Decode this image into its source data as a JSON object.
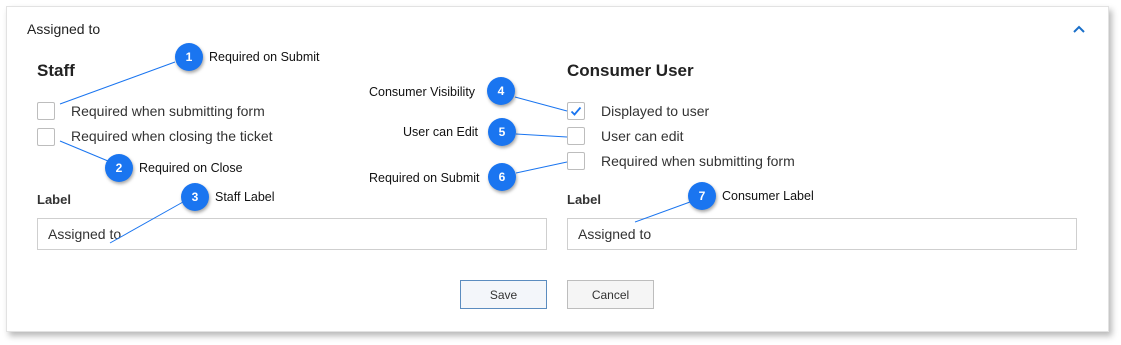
{
  "header": {
    "title": "Assigned to",
    "collapse_icon": "chevron-up-icon"
  },
  "staff": {
    "title": "Staff",
    "checkboxes": [
      {
        "label": "Required when submitting form",
        "checked": false
      },
      {
        "label": "Required when closing the ticket",
        "checked": false
      }
    ],
    "label_caption": "Label",
    "label_value": "Assigned to"
  },
  "consumer": {
    "title": "Consumer User",
    "checkboxes": [
      {
        "label": "Displayed to user",
        "checked": true
      },
      {
        "label": "User can edit",
        "checked": false
      },
      {
        "label": "Required when submitting form",
        "checked": false
      }
    ],
    "label_caption": "Label",
    "label_value": "Assigned to"
  },
  "buttons": {
    "save": "Save",
    "cancel": "Cancel"
  },
  "callouts": [
    {
      "number": "1",
      "text": "Required on Submit"
    },
    {
      "number": "2",
      "text": "Required on Close"
    },
    {
      "number": "3",
      "text": "Staff Label"
    },
    {
      "number": "4",
      "text": "Consumer Visibility"
    },
    {
      "number": "5",
      "text": "User can Edit"
    },
    {
      "number": "6",
      "text": "Required on Submit"
    },
    {
      "number": "7",
      "text": "Consumer Label"
    }
  ],
  "colors": {
    "callout": "#1a75f0",
    "checkmark": "#1a75f0",
    "primary_border": "#5b8cbf"
  }
}
